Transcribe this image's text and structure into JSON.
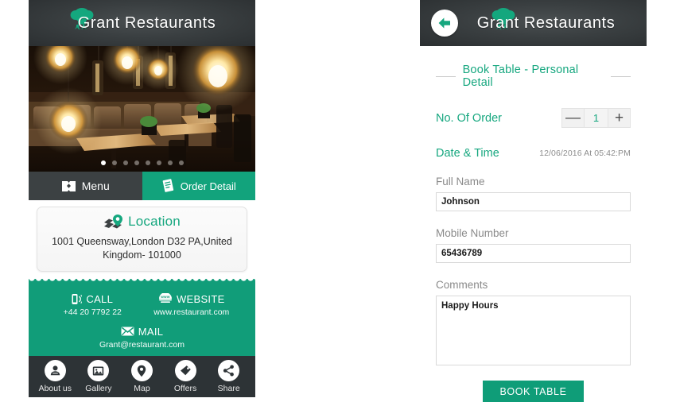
{
  "brand": {
    "name_prefix": "G",
    "name_rest": "rant Restaurants",
    "full_name": "Grant Restaurants",
    "accent_green": "#12a37c",
    "dark_header": "#3a3f41"
  },
  "left": {
    "carousel": {
      "alt": "restaurant-interior-photo",
      "total_dots": 8,
      "active_dot": 1
    },
    "tabs": [
      {
        "label": "Menu",
        "icon": "open-book-icon",
        "active": false
      },
      {
        "label": "Order Detail",
        "icon": "receipt-document-icon",
        "active": true
      }
    ],
    "location": {
      "icon": "map-pin-icon",
      "title": "Location",
      "address": "1001 Queensway,London D32 PA,United Kingdom- 101000"
    },
    "contact": {
      "call": {
        "icon": "phone-icon",
        "label": "CALL",
        "value": "+44 20 7792 22"
      },
      "website": {
        "icon": "www-globe-icon",
        "label": "WEBSITE",
        "value": "www.restaurant.com"
      },
      "mail": {
        "icon": "envelope-icon",
        "label": "MAIL",
        "value": "Grant@restaurant.com"
      }
    },
    "bottom_nav": [
      {
        "label": "About us",
        "icon": "person-icon"
      },
      {
        "label": "Gallery",
        "icon": "photo-icon"
      },
      {
        "label": "Map",
        "icon": "pin-icon"
      },
      {
        "label": "Offers",
        "icon": "tag-icon"
      },
      {
        "label": "Share",
        "icon": "share-icon"
      }
    ]
  },
  "right": {
    "back_icon": "back-arrow-icon",
    "section_title": "Book Table - Personal Detail",
    "order": {
      "label": "No. Of Order",
      "decrement": "—",
      "value": "1",
      "increment": "+"
    },
    "datetime": {
      "label": "Date & Time",
      "value": "12/06/2016 At 05:42:PM"
    },
    "fields": [
      {
        "label": "Full Name",
        "value": "Johnson",
        "placeholder": "Full Name"
      },
      {
        "label": "Mobile Number",
        "value": "65436789",
        "placeholder": "Mobile Number"
      }
    ],
    "comments": {
      "label": "Comments",
      "value": "Happy Hours",
      "placeholder": "Comments"
    },
    "submit_label": "BOOK TABLE"
  }
}
